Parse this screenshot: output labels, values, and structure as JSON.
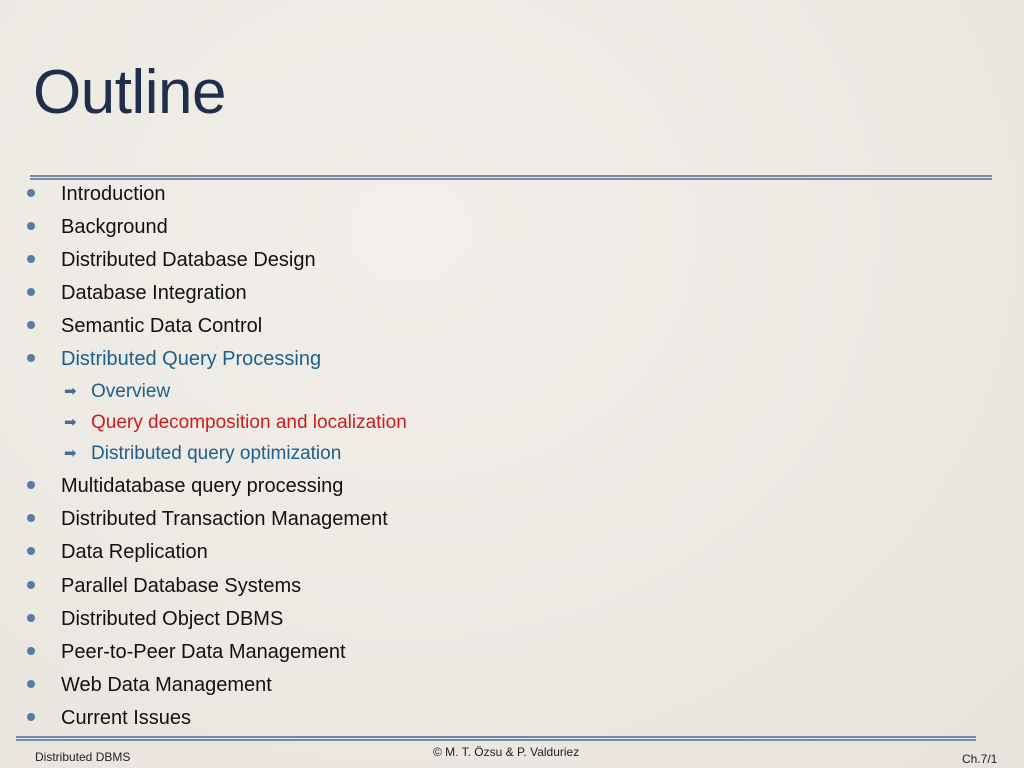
{
  "slide": {
    "title": "Outline",
    "items": [
      {
        "label": "Introduction",
        "color": "#111111"
      },
      {
        "label": "Background",
        "color": "#111111"
      },
      {
        "label": "Distributed Database Design",
        "color": "#111111"
      },
      {
        "label": "Database Integration",
        "color": "#111111"
      },
      {
        "label": "Semantic Data Control",
        "color": "#111111"
      },
      {
        "label": "Distributed Query Processing",
        "color": "#1d5f8c"
      }
    ],
    "subitems": [
      {
        "label": "Overview",
        "color": "#1d5f8c"
      },
      {
        "label": "Query decomposition and localization",
        "color": "#cc1c1c"
      },
      {
        "label": "Distributed query optimization",
        "color": "#1d5f8c"
      }
    ],
    "items_after": [
      {
        "label": "Multidatabase query processing"
      },
      {
        "label": "Distributed Transaction Management"
      },
      {
        "label": "Data Replication"
      },
      {
        "label": "Parallel Database Systems"
      },
      {
        "label": "Distributed Object DBMS"
      },
      {
        "label": "Peer-to-Peer Data Management"
      },
      {
        "label": "Web Data Management"
      },
      {
        "label": "Current Issues"
      }
    ],
    "bullet_icon": "bullet-dot",
    "sub_bullet_icon": "right-arrow",
    "sub_bullet_glyph": "➡"
  },
  "footer": {
    "left": "Distributed DBMS",
    "center": "© M. T. Özsu & P. Valduriez",
    "right": "Ch.7/1"
  }
}
